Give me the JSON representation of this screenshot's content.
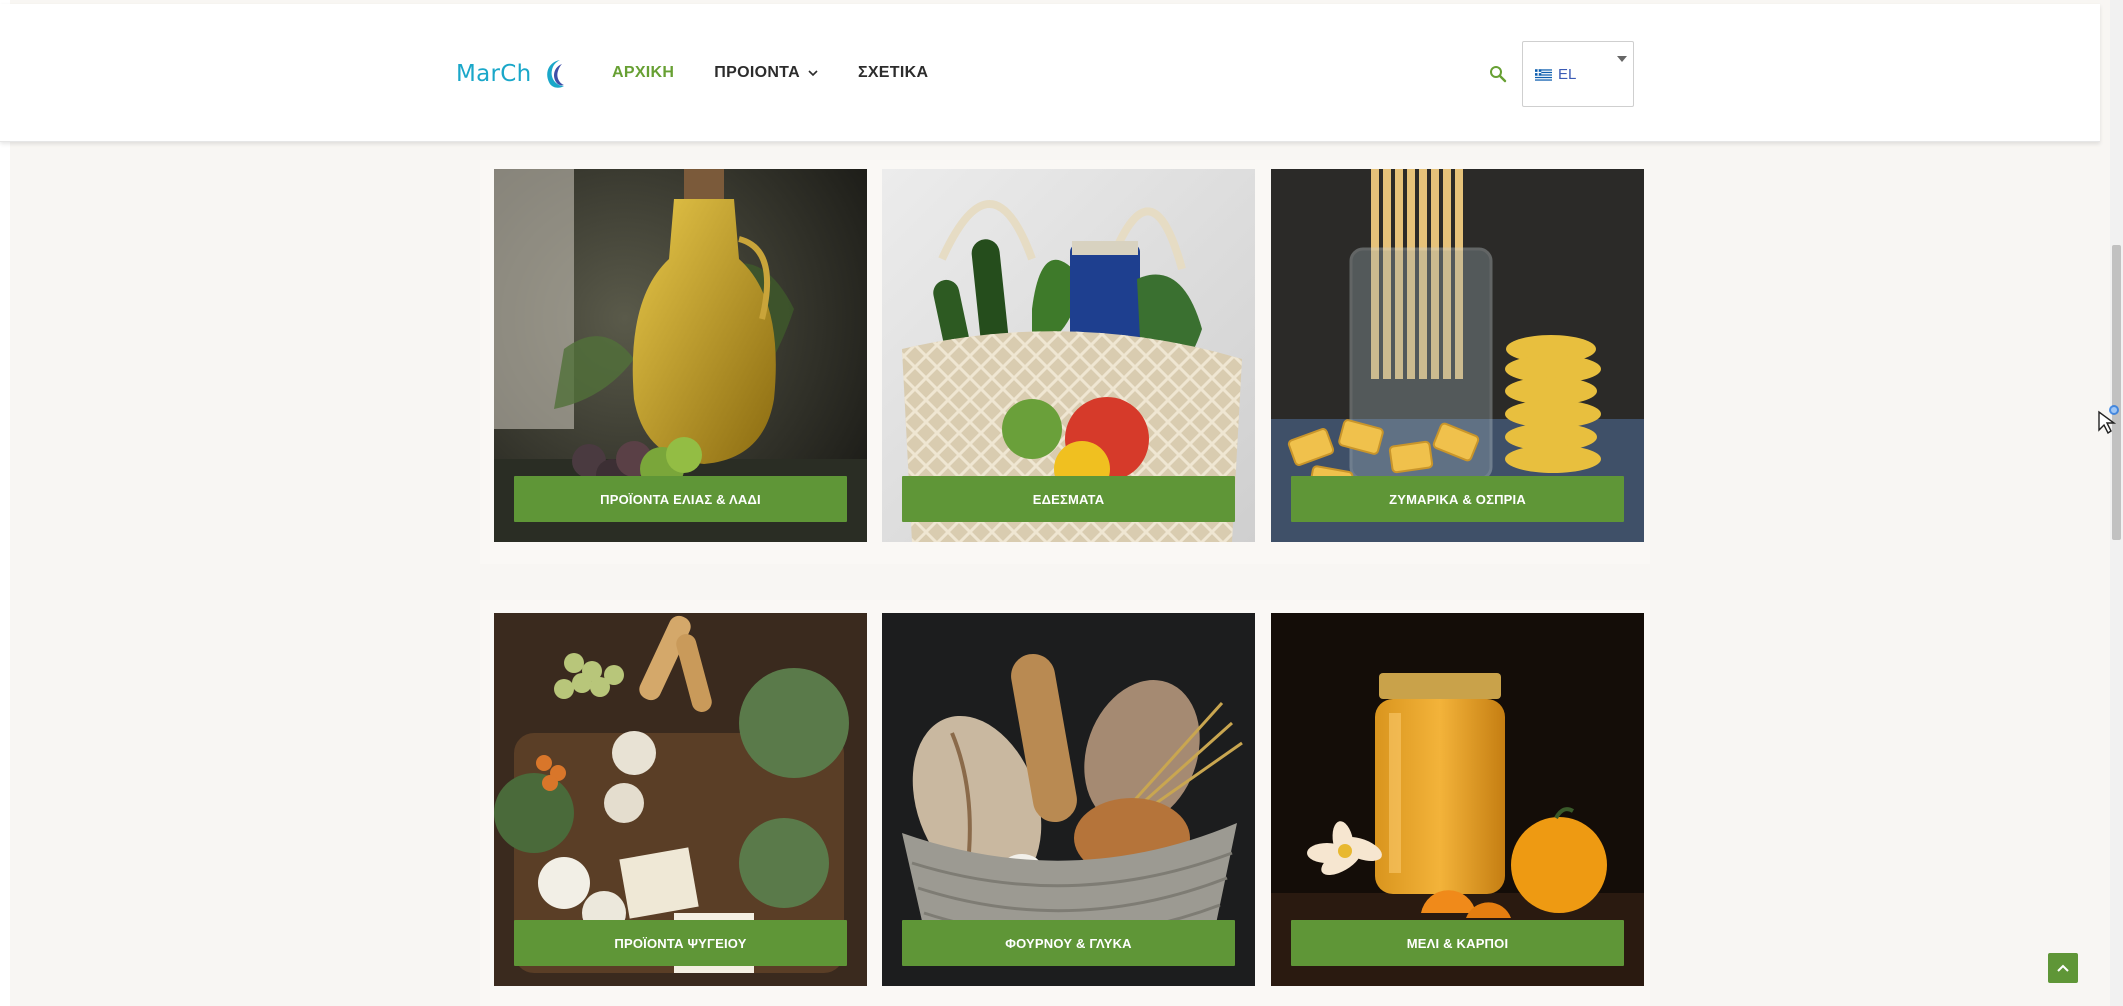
{
  "header": {
    "logo_text": "MarCh",
    "nav": [
      {
        "label": "ΑΡΧΙΚΗ",
        "active": true
      },
      {
        "label": "ΠΡΟΙΟΝΤΑ",
        "has_dropdown": true
      },
      {
        "label": "ΣΧΕΤΙΚΑ"
      }
    ],
    "search_icon": "search-icon",
    "language": {
      "code": "EL",
      "flag": "greek-flag-icon"
    }
  },
  "categories": [
    {
      "label": "ΠΡΟΪΟΝΤΑ ΕΛΙΑΣ & ΛΑΔΙ",
      "image": "olive-oil-bottle"
    },
    {
      "label": "ΕΔΕΣΜΑΤΑ",
      "image": "grocery-net-bag"
    },
    {
      "label": "ΖΥΜΑΡΙΚΑ & ΟΣΠΡΙΑ",
      "image": "pasta-jar"
    },
    {
      "label": "ΠΡΟΪΟΝΤΑ ΨΥΓΕΙΟΥ",
      "image": "cheese-platter"
    },
    {
      "label": "ΦΟΥΡΝΟΥ & ΓΛΥΚΑ",
      "image": "bread-basket"
    },
    {
      "label": "ΜΕΛΙ & ΚΑΡΠΟΙ",
      "image": "honey-jar"
    }
  ],
  "colors": {
    "accent": "#5f9637",
    "nav_active": "#67a033",
    "logo": "#1aa7c9",
    "page_bg": "#f8f6f3"
  }
}
